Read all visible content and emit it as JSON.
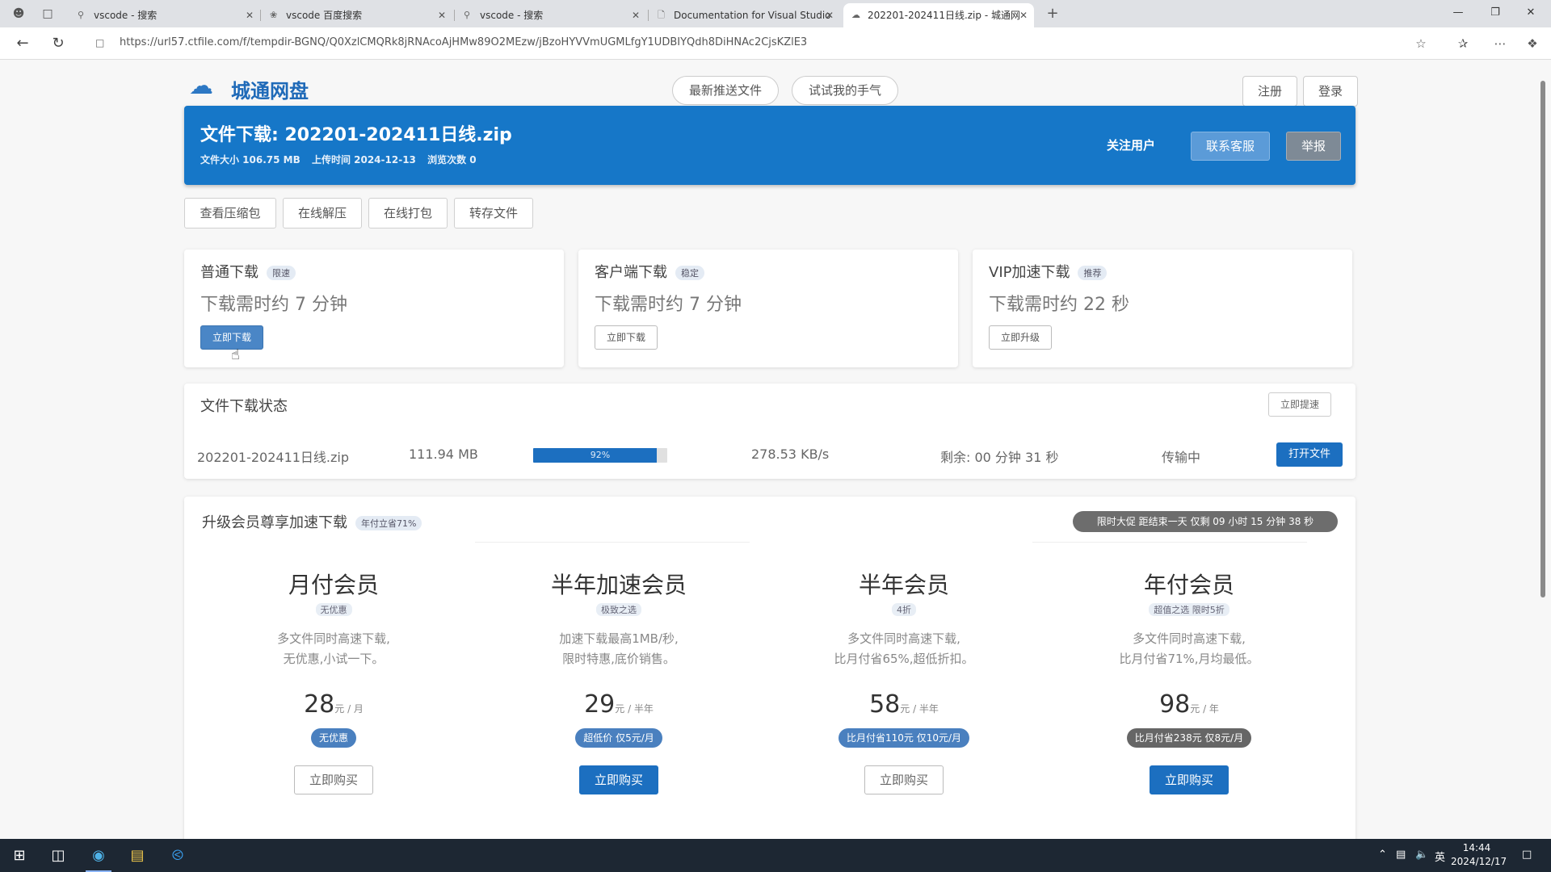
{
  "browser": {
    "tabs": [
      {
        "label": "vscode - 搜索",
        "icon": "search-icon"
      },
      {
        "label": "vscode 百度搜索",
        "icon": "paw-icon"
      },
      {
        "label": "vscode - 搜索",
        "icon": "search-icon"
      },
      {
        "label": "Documentation for Visual Studio",
        "icon": "document-icon"
      },
      {
        "label": "202201-202411日线.zip - 城通网",
        "icon": "cloud-icon",
        "active": true
      }
    ],
    "new_tab": "+",
    "url": "https://url57.ctfile.com/f/tempdir-BGNQ/Q0XzlCMQRk8jRNAcoAjHMw89O2MEzw/jBzoHYVVmUGMLfgY1UDBIYQdh8DiHNAc2CjsKZlE3"
  },
  "site": {
    "logo": "城通网盘",
    "nav_latest": "最新推送文件",
    "nav_luck": "试试我的手气",
    "register": "注册",
    "login": "登录"
  },
  "banner": {
    "title": "文件下载: 202201-202411日线.zip",
    "size": "文件大小 106.75 MB",
    "upload": "上传时间 2024-12-13",
    "views": "浏览次数 0",
    "follow": "关注用户",
    "contact": "联系客服",
    "report": "举报"
  },
  "tools": [
    "查看压缩包",
    "在线解压",
    "在线打包",
    "转存文件"
  ],
  "download_options": [
    {
      "title": "普通下载",
      "badge": "限速",
      "time": "下载需时约 7 分钟",
      "button": "立即下载"
    },
    {
      "title": "客户端下载",
      "badge": "稳定",
      "time": "下载需时约 7 分钟",
      "button": "立即下载"
    },
    {
      "title": "VIP加速下载",
      "badge": "推荐",
      "time": "下载需时约 22 秒",
      "button": "立即升级"
    }
  ],
  "status": {
    "title": "文件下载状态",
    "speedup": "立即提速",
    "file": "202201-202411日线.zip",
    "size": "111.94 MB",
    "progress": 92,
    "progress_label": "92%",
    "speed": "278.53 KB/s",
    "remaining": "剩余: 00 分钟 31 秒",
    "state": "传输中",
    "open": "打开文件"
  },
  "vip": {
    "title": "升级会员尊享加速下载",
    "title_badge": "年付立省71%",
    "timer": "限时大促 距结束一天 仅剩 09 小时 15 分钟 38 秒",
    "plans": [
      {
        "name": "月付会员",
        "sub": "无优惠",
        "desc1": "多文件同时高速下载,",
        "desc2": "无优惠,小试一下。",
        "price": "28",
        "unit": "元 / 月",
        "badge": "无优惠",
        "button": "立即购买",
        "primary": false,
        "dark": false
      },
      {
        "name": "半年加速会员",
        "sub": "极致之选",
        "desc1": "加速下载最高1MB/秒,",
        "desc2": "限时特惠,底价销售。",
        "price": "29",
        "unit": "元 / 半年",
        "badge": "超低价 仅5元/月",
        "button": "立即购买",
        "primary": true,
        "dark": false
      },
      {
        "name": "半年会员",
        "sub": "4折",
        "desc1": "多文件同时高速下载,",
        "desc2": "比月付省65%,超低折扣。",
        "price": "58",
        "unit": "元 / 半年",
        "badge": "比月付省110元 仅10元/月",
        "button": "立即购买",
        "primary": false,
        "dark": false
      },
      {
        "name": "年付会员",
        "sub": "超值之选 限时5折",
        "desc1": "多文件同时高速下载,",
        "desc2": "比月付省71%,月均最低。",
        "price": "98",
        "unit": "元 / 年",
        "badge": "比月付省238元 仅8元/月",
        "button": "立即购买",
        "primary": true,
        "dark": true
      }
    ]
  },
  "taskbar": {
    "ime": "英",
    "time": "14:44",
    "date": "2024/12/17"
  }
}
